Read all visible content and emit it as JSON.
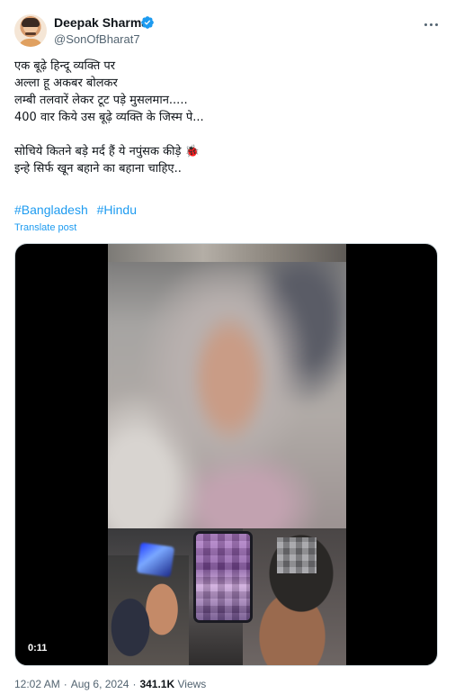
{
  "author": {
    "display_name": "Deepak Sharma",
    "handle": "@SonOfBharat7",
    "verified": true
  },
  "post": {
    "lines": [
      "एक बूढ़े हिन्दू व्यक्ति पर",
      "अल्ला हू अकबर बोलकर",
      "लम्बी तलवारें लेकर टूट पड़े मुसलमान.....",
      "400 वार किये उस बूढ़े व्यक्ति के जिस्म पे...",
      "",
      "सोचिये कितने बड़े मर्द हैं ये नपुंसक कीड़े 🐞",
      "इन्हे सिर्फ खून बहाने का बहाना चाहिए.."
    ],
    "hashtags": [
      "#Bangladesh",
      "#Hindu"
    ],
    "translate_label": "Translate post"
  },
  "media": {
    "duration": "0:11"
  },
  "meta": {
    "time": "12:02 AM",
    "separator": "·",
    "date": "Aug 6, 2024",
    "views_count": "341.1K",
    "views_label": "Views"
  },
  "colors": {
    "accent": "#1d9bf0",
    "text": "#0f1419",
    "secondary": "#536471"
  }
}
